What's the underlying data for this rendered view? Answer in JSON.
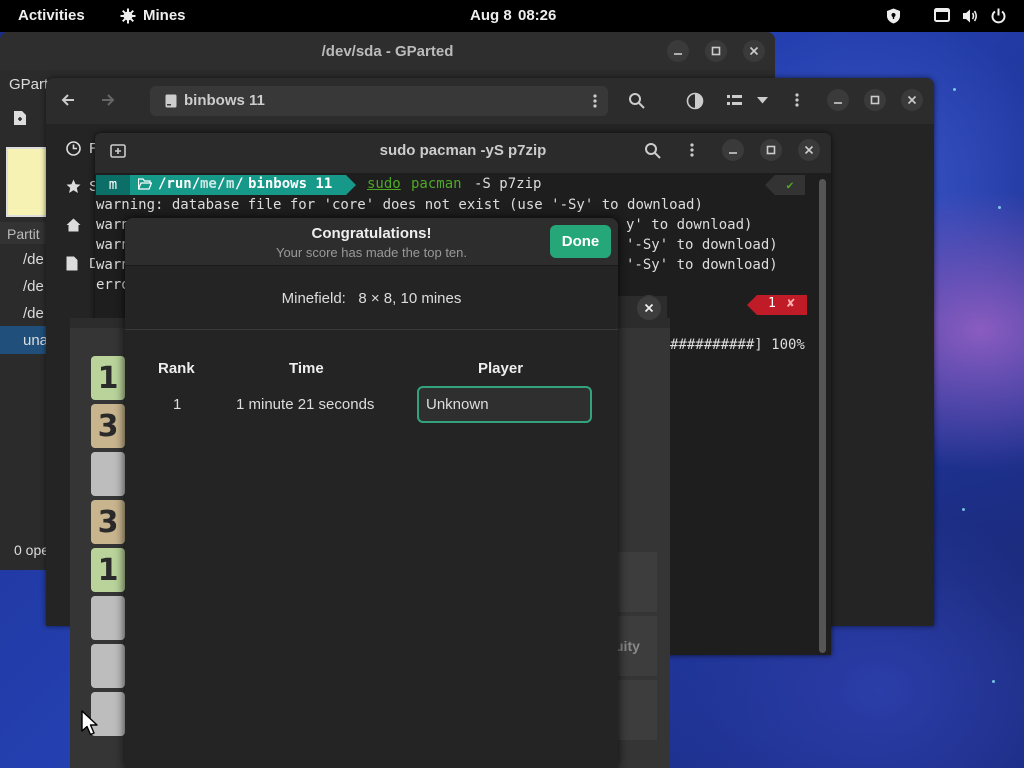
{
  "topbar": {
    "activities": "Activities",
    "app_name": "Mines",
    "date": "Aug 8",
    "time": "08:26"
  },
  "gparted": {
    "title": "/dev/sda - GParted",
    "app_label": "GPart",
    "partition_header": "Partit",
    "rows": [
      "/de",
      "/de",
      "/de",
      "una"
    ],
    "status": "0 ope"
  },
  "files": {
    "path": "binbows 11",
    "sidebar_letters": [
      "R",
      "S",
      "D"
    ]
  },
  "terminal": {
    "title": "sudo pacman -yS p7zip",
    "prompt": {
      "user_badge": "m",
      "path_prefix": "/run/",
      "path_me": "me",
      "path_sep1": "/",
      "path_m": "m",
      "path_sep2": "/",
      "path_dir": "binbows 11",
      "cmd_sudo": "sudo",
      "cmd_pacman": "pacman",
      "cmd_args": "-S p7zip",
      "status_ok": "✔"
    },
    "lines": [
      "warning: database file for 'core' does not exist (use '-Sy' to download)",
      "warn",
      "warn",
      "warn",
      "erro"
    ],
    "line_tails": [
      "y' to download)",
      "'-Sy' to download)",
      "'-Sy' to download)"
    ],
    "progress_tail": "##########] 100%",
    "error_count": "1",
    "error_mark": "✘"
  },
  "mines": {
    "tiles": [
      {
        "label": "1",
        "color": "#b9d39a"
      },
      {
        "label": "3",
        "color": "#c8b58e"
      },
      {
        "label": "",
        "color": "#bdbdbd"
      },
      {
        "label": "3",
        "color": "#c8b58e"
      },
      {
        "label": "1",
        "color": "#b9d39a"
      },
      {
        "label": "",
        "color": "#bdbdbd"
      },
      {
        "label": "",
        "color": "#bdbdbd"
      },
      {
        "label": "",
        "color": "#bdbdbd"
      }
    ],
    "side_text": "uity"
  },
  "scores_dialog": {
    "title": "Congratulations!",
    "subtitle": "Your score has made the top ten.",
    "done_label": "Done",
    "minefield_label": "Minefield:",
    "minefield_value": "8 × 8, 10 mines",
    "columns": {
      "rank": "Rank",
      "time": "Time",
      "player": "Player"
    },
    "row": {
      "rank": "1",
      "time": "1 minute 21 seconds",
      "player": "Unknown"
    }
  },
  "colors": {
    "accent": "#26a77a",
    "prompt_teal": "#1a9a8c",
    "error_red": "#c01c28"
  }
}
